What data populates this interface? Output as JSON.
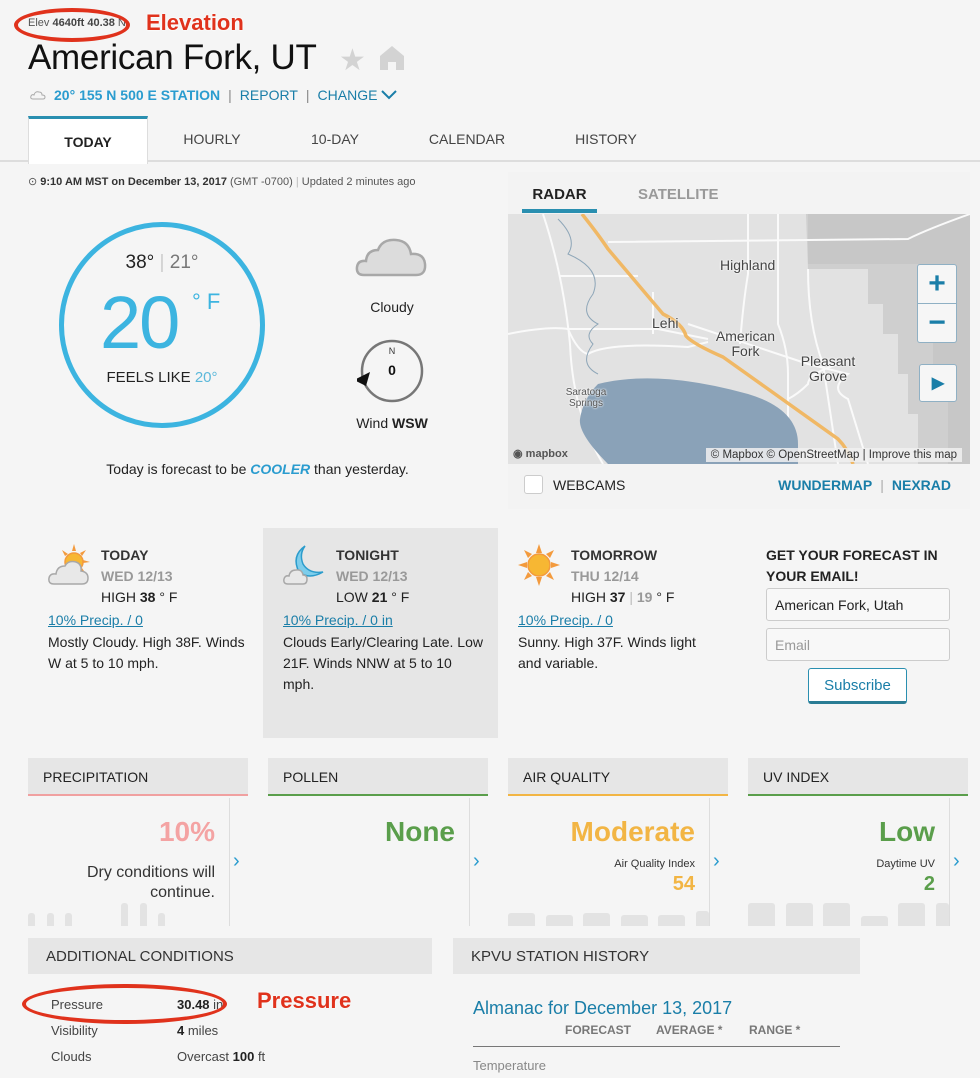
{
  "header": {
    "elevation_label": "Elev",
    "elevation_value": "4640ft",
    "latitude_fragment": "40.38",
    "latitude_trailing": "N,",
    "elevation_annotation": "Elevation",
    "city": "American Fork, UT",
    "favorite_icon": "star-icon",
    "home_icon": "home-icon",
    "station_temp": "20°",
    "station_name": "155 N 500 E STATION",
    "report_label": "REPORT",
    "change_label": "CHANGE",
    "separator": "|"
  },
  "tabs": [
    {
      "label": "TODAY",
      "active": true
    },
    {
      "label": "HOURLY",
      "active": false
    },
    {
      "label": "10-DAY",
      "active": false
    },
    {
      "label": "CALENDAR",
      "active": false
    },
    {
      "label": "HISTORY",
      "active": false
    }
  ],
  "timestamp": {
    "time": "9:10 AM MST on December 13, 2017",
    "zone": "(GMT -0700)",
    "separator": "|",
    "updated": "Updated 2 minutes ago"
  },
  "current": {
    "high": "38°",
    "low": "21°",
    "pipe": "|",
    "temp": "20",
    "unit": "° F",
    "feels_like_label": "FEELS LIKE",
    "feels_like_value": "20°",
    "condition": "Cloudy",
    "wind_compass_n": "N",
    "wind_speed": "0",
    "wind_label": "Wind",
    "wind_dir": "WSW",
    "compare_prefix": "Today is forecast to be",
    "compare_word": "COOLER",
    "compare_suffix": "than yesterday."
  },
  "radar": {
    "tabs": [
      {
        "label": "RADAR",
        "active": true
      },
      {
        "label": "SATELLITE",
        "active": false
      }
    ],
    "places": [
      {
        "name": "Highland"
      },
      {
        "name": "Lehi"
      },
      {
        "name": "American Fork"
      },
      {
        "name": "Pleasant Grove"
      },
      {
        "name": "Saratoga Springs"
      }
    ],
    "zoom_in": "+",
    "zoom_out": "−",
    "play": "▶",
    "mapbox_logo": "mapbox",
    "attribution": "© Mapbox © OpenStreetMap | Improve this map",
    "webcams_label": "WEBCAMS",
    "wundermap_label": "WUNDERMAP",
    "nexrad_label": "NEXRAD",
    "separator": "|"
  },
  "forecast": [
    {
      "period": "TODAY",
      "date": "WED 12/13",
      "temp_label": "HIGH",
      "temp": "38",
      "low": "",
      "unit": "° F",
      "precip": "10% Precip. / 0",
      "desc": "Mostly Cloudy. High 38F. Winds W at 5 to 10 mph.",
      "icon": "partly-cloudy-icon"
    },
    {
      "period": "TONIGHT",
      "date": "WED 12/13",
      "temp_label": "LOW",
      "temp": "21",
      "low": "",
      "unit": "° F",
      "precip": "10% Precip. / 0 in",
      "desc": "Clouds Early/Clearing Late. Low 21F. Winds NNW at 5 to 10 mph.",
      "icon": "moon-cloud-icon"
    },
    {
      "period": "TOMORROW",
      "date": "THU 12/14",
      "temp_label": "HIGH",
      "temp": "37",
      "low": "19",
      "unit": "° F",
      "precip": "10% Precip. / 0",
      "desc": "Sunny. High 37F. Winds light and variable.",
      "icon": "sun-icon"
    }
  ],
  "email": {
    "title": "GET YOUR FORECAST IN YOUR EMAIL!",
    "location_value": "American Fork, Utah",
    "email_placeholder": "Email",
    "subscribe_label": "Subscribe"
  },
  "modules": [
    {
      "title": "PRECIPITATION",
      "value": "10%",
      "sub": "Dry conditions will continue.",
      "accent": "#f0a0a0"
    },
    {
      "title": "POLLEN",
      "value": "None",
      "sub": "",
      "accent": "#5a9e4b"
    },
    {
      "title": "AIR QUALITY",
      "value": "Moderate",
      "sub_label": "Air Quality Index",
      "sub_value": "54",
      "accent": "#f2b544"
    },
    {
      "title": "UV INDEX",
      "value": "Low",
      "sub_label": "Daytime UV",
      "sub_value": "2",
      "accent": "#5a9e4b"
    }
  ],
  "additional": {
    "title": "ADDITIONAL CONDITIONS",
    "rows": [
      {
        "label": "Pressure",
        "value_bold": "30.48",
        "value_rest": " in"
      },
      {
        "label": "Visibility",
        "value_bold": "4",
        "value_rest": " miles"
      },
      {
        "label": "Clouds",
        "value_pre": "Overcast ",
        "value_bold": "100",
        "value_rest": " ft"
      }
    ],
    "pressure_annotation": "Pressure"
  },
  "history": {
    "title": "KPVU STATION HISTORY",
    "almanac_title": "Almanac for December 13, 2017",
    "columns": [
      "FORECAST",
      "AVERAGE *",
      "RANGE *"
    ],
    "first_row": "Temperature"
  }
}
